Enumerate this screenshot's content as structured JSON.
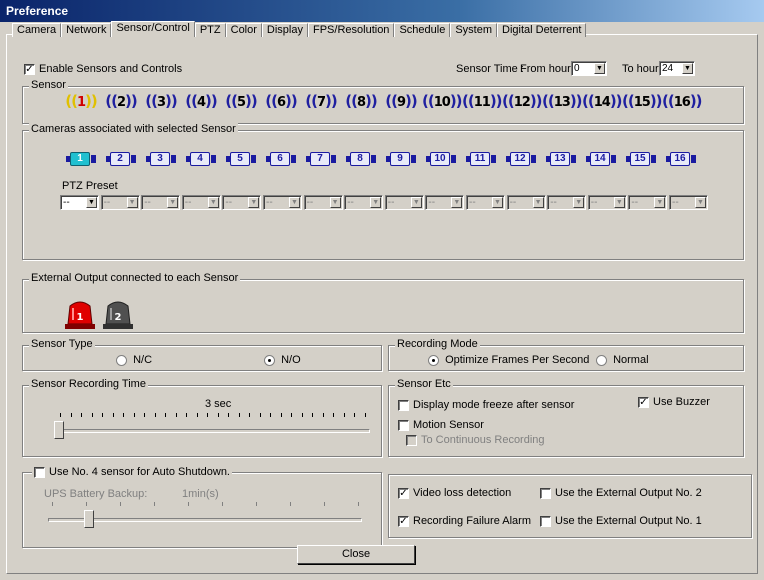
{
  "window": {
    "title": "Preference"
  },
  "tabs": [
    {
      "label": "Camera"
    },
    {
      "label": "Network"
    },
    {
      "label": "Sensor/Control",
      "active": true
    },
    {
      "label": "PTZ"
    },
    {
      "label": "Color"
    },
    {
      "label": "Display"
    },
    {
      "label": "FPS/Resolution"
    },
    {
      "label": "Schedule"
    },
    {
      "label": "System"
    },
    {
      "label": "Digital Deterrent"
    }
  ],
  "enable": {
    "label": "Enable Sensors and Controls",
    "checked": true
  },
  "sensor_time": {
    "label": "Sensor Time :",
    "from_label": "From hour",
    "from_value": "0",
    "to_label": "To hour",
    "to_value": "24"
  },
  "sensor_group": {
    "legend": "Sensor",
    "sensors": [
      "1",
      "2",
      "3",
      "4",
      "5",
      "6",
      "7",
      "8",
      "9",
      "10",
      "11",
      "12",
      "13",
      "14",
      "15",
      "16"
    ],
    "selected": "1"
  },
  "cameras_group": {
    "legend": "Cameras associated with selected Sensor",
    "cameras": [
      "1",
      "2",
      "3",
      "4",
      "5",
      "6",
      "7",
      "8",
      "9",
      "10",
      "11",
      "12",
      "13",
      "14",
      "15",
      "16"
    ],
    "selected": "1",
    "ptz_label": "PTZ Preset",
    "ptz_values": [
      "--",
      "--",
      "--",
      "--",
      "--",
      "--",
      "--",
      "--",
      "--",
      "--",
      "--",
      "--",
      "--",
      "--",
      "--",
      "--"
    ]
  },
  "external_output": {
    "legend": "External Output connected to each Sensor",
    "outputs": [
      {
        "label": "1",
        "color": "#e00000"
      },
      {
        "label": "2",
        "color": "#505050"
      }
    ]
  },
  "sensor_type": {
    "legend": "Sensor Type",
    "options": [
      "N/C",
      "N/O"
    ],
    "selected": "N/O"
  },
  "recording_mode": {
    "legend": "Recording Mode",
    "options": [
      "Optimize Frames Per Second",
      "Normal"
    ],
    "selected": "Optimize Frames Per Second"
  },
  "sensor_recording_time": {
    "legend": "Sensor Recording Time",
    "value_label": "3 sec",
    "level": 0.0
  },
  "sensor_etc": {
    "legend": "Sensor Etc",
    "display_freeze": {
      "label": "Display mode freeze after sensor",
      "checked": false
    },
    "use_buzzer": {
      "label": "Use Buzzer",
      "checked": true
    },
    "motion_sensor": {
      "label": "Motion Sensor",
      "checked": false
    },
    "to_continuous": {
      "label": "To Continuous Recording",
      "checked": false,
      "disabled": true
    }
  },
  "auto_shutdown": {
    "label": "Use No.  4  sensor for Auto Shutdown.",
    "checked": false,
    "ups_label": "UPS Battery Backup:",
    "ups_value": "1min(s)",
    "level": 0.1
  },
  "alarms": {
    "video_loss": {
      "label": "Video loss detection",
      "checked": true
    },
    "ext_out_2": {
      "label": "Use the External Output No. 2",
      "checked": false
    },
    "rec_failure": {
      "label": "Recording Failure Alarm",
      "checked": true
    },
    "ext_out_1": {
      "label": "Use the External Output No. 1",
      "checked": false
    }
  },
  "close_label": "Close"
}
